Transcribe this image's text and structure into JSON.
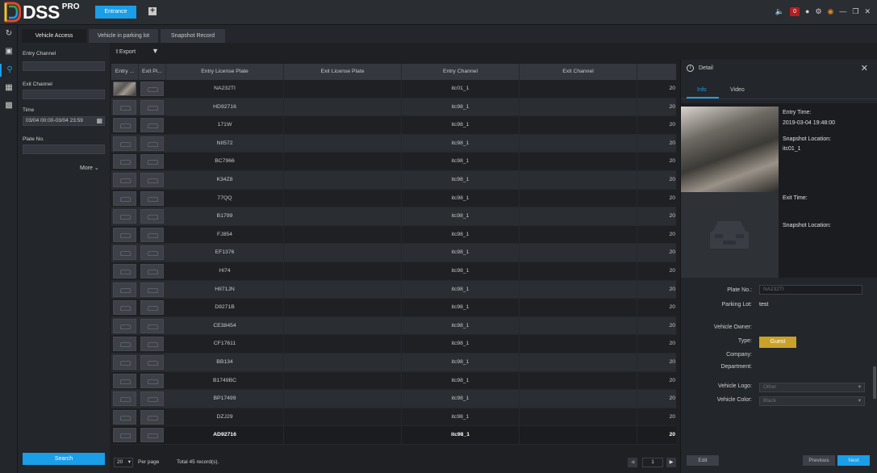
{
  "app": {
    "name": "DSS",
    "edition": "PRO"
  },
  "topbar": {
    "tab_label": "Entrance",
    "alarm_count": "0"
  },
  "subtabs": [
    "Vehicle Access",
    "Vehicle in parking lot",
    "Snapshot Record"
  ],
  "filter": {
    "entry_channel_label": "Entry Channel",
    "exit_channel_label": "Exit Channel",
    "time_label": "Time",
    "time_value": "03/04 00:00-03/04 23:59",
    "plate_label": "Plate No.",
    "more_label": "More",
    "search_label": "Search"
  },
  "toolbar": {
    "export_label": "Export"
  },
  "table": {
    "headers": [
      "Entry ...",
      "Exit Pi...",
      "Entry License Plate",
      "Exit License Plate",
      "Entry Channel",
      "Exit Channel",
      ""
    ],
    "rows": [
      {
        "plate": "NA232TI",
        "channel": "itc01_1",
        "time": "20"
      },
      {
        "plate": "HD92716",
        "channel": "itc98_1",
        "time": "20"
      },
      {
        "plate": "171W",
        "channel": "itc98_1",
        "time": "20"
      },
      {
        "plate": "NII572",
        "channel": "itc98_1",
        "time": "20"
      },
      {
        "plate": "BC7966",
        "channel": "itc98_1",
        "time": "20"
      },
      {
        "plate": "K34Z8",
        "channel": "itc98_1",
        "time": "20"
      },
      {
        "plate": "77QQ",
        "channel": "itc98_1",
        "time": "20"
      },
      {
        "plate": "B1799",
        "channel": "itc98_1",
        "time": "20"
      },
      {
        "plate": "FJ854",
        "channel": "itc98_1",
        "time": "20"
      },
      {
        "plate": "EF1376",
        "channel": "itc98_1",
        "time": "20"
      },
      {
        "plate": "HI74",
        "channel": "itc98_1",
        "time": "20"
      },
      {
        "plate": "HII71JN",
        "channel": "itc98_1",
        "time": "20"
      },
      {
        "plate": "D9271B",
        "channel": "itc98_1",
        "time": "20"
      },
      {
        "plate": "CE38454",
        "channel": "itc98_1",
        "time": "20"
      },
      {
        "plate": "CF17611",
        "channel": "itc98_1",
        "time": "20"
      },
      {
        "plate": "BB134",
        "channel": "itc98_1",
        "time": "20"
      },
      {
        "plate": "B1749BC",
        "channel": "itc98_1",
        "time": "20"
      },
      {
        "plate": "BP17499",
        "channel": "itc98_1",
        "time": "20"
      },
      {
        "plate": "DZJ29",
        "channel": "itc98_1",
        "time": "20"
      },
      {
        "plate": "AD92716",
        "channel": "itc98_1",
        "time": "20"
      }
    ]
  },
  "pager": {
    "per_page_value": "20",
    "per_page_label": "Per page",
    "total_label": "Total 45 record(s).",
    "current_page": "1"
  },
  "detail": {
    "title": "Detail",
    "tabs": [
      "Info",
      "Video"
    ],
    "entry_time_label": "Entry Time:",
    "entry_time_value": "2019-03-04 19:48:00",
    "snapshot_location_label": "Snapshot Location:",
    "entry_location_value": "itc01_1",
    "exit_time_label": "Exit Time:",
    "exit_snapshot_location_label": "Snapshot Location:",
    "plate_no_label": "Plate No.:",
    "plate_no_value": "NA232TI",
    "parking_lot_label": "Parking Lot:",
    "parking_lot_value": "test",
    "owner_label": "Vehicle Owner:",
    "type_label": "Type:",
    "type_value": "Guest",
    "company_label": "Company:",
    "department_label": "Department:",
    "logo_label": "Vehicle Logo:",
    "logo_value": "Other",
    "color_label": "Vehicle Color:",
    "color_value": "Black",
    "edit_label": "Edit",
    "previous_label": "Previous",
    "next_label": "Next"
  },
  "colors": {
    "accent": "#1a9ee8",
    "guest": "#c9a227",
    "alarm": "#b02020"
  }
}
